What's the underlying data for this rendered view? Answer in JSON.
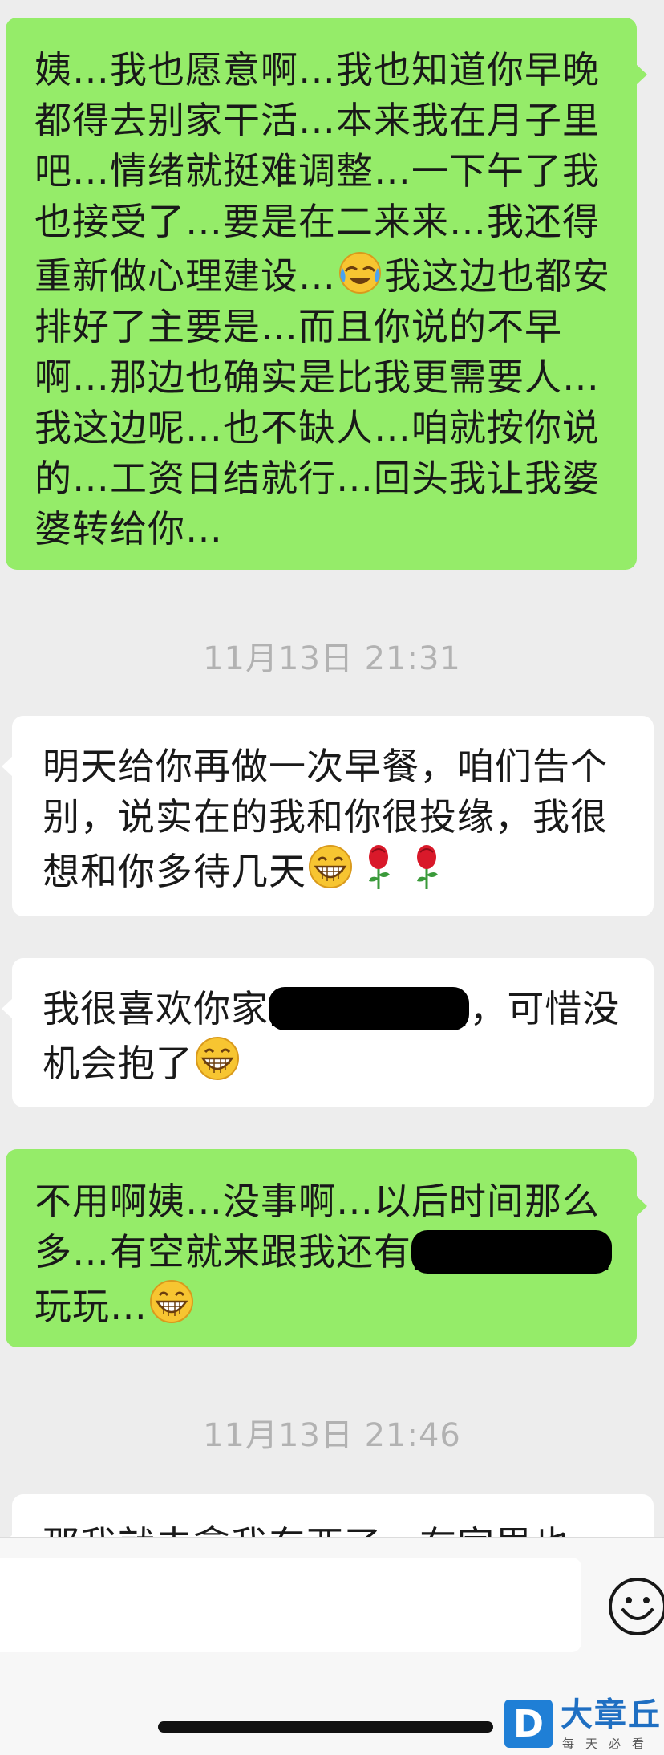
{
  "messages": [
    {
      "side": "right",
      "text": "姨…我也愿意啊…我也知道你早晚都得去别家干活…本来我在月子里吧…情绪就挺难调整…一下午了我也接受了…要是在二来来…我还得重新做心理建设…",
      "emoji": "face-with-tears-of-joy",
      "text_after": "我这边也都安排好了主要是…而且你说的不早啊…那边也确实是比我更需要人…我这边呢…也不缺人…咱就按你说的…工资日结就行…回头我让我婆婆转给你…"
    },
    {
      "type": "time",
      "text": "11月13日 21:31"
    },
    {
      "side": "left",
      "text": "明天给你再做一次早餐，咱们告个别，说实在的我和你很投缘，我很想和你多待几天",
      "emojis": [
        "grinning-face",
        "rose",
        "rose"
      ]
    },
    {
      "side": "left",
      "text_before": "我很喜欢你家",
      "redacted": "[redacted]",
      "text_after": "，可惜没机会抱了",
      "emoji": "grinning-face"
    },
    {
      "side": "right",
      "text_before": "不用啊姨…没事啊…以后时间那么多…有空就来跟我还有",
      "redacted": "[redacted]",
      "text_after": "玩玩…",
      "emoji": "grinning-face"
    },
    {
      "type": "time",
      "text": "11月13日 21:46"
    },
    {
      "side": "left",
      "text": "那我就去拿我东西了，在家里也"
    }
  ],
  "input": {
    "placeholder": "",
    "emoji_button": "smiley-icon"
  },
  "watermark": {
    "title": "大章丘",
    "subtitle": "每天必看",
    "logo_letter": "D"
  },
  "colors": {
    "bubble_mine": "#95ec69",
    "bubble_theirs": "#ffffff",
    "background": "#ededed",
    "timestamp": "#b2b2b2"
  }
}
